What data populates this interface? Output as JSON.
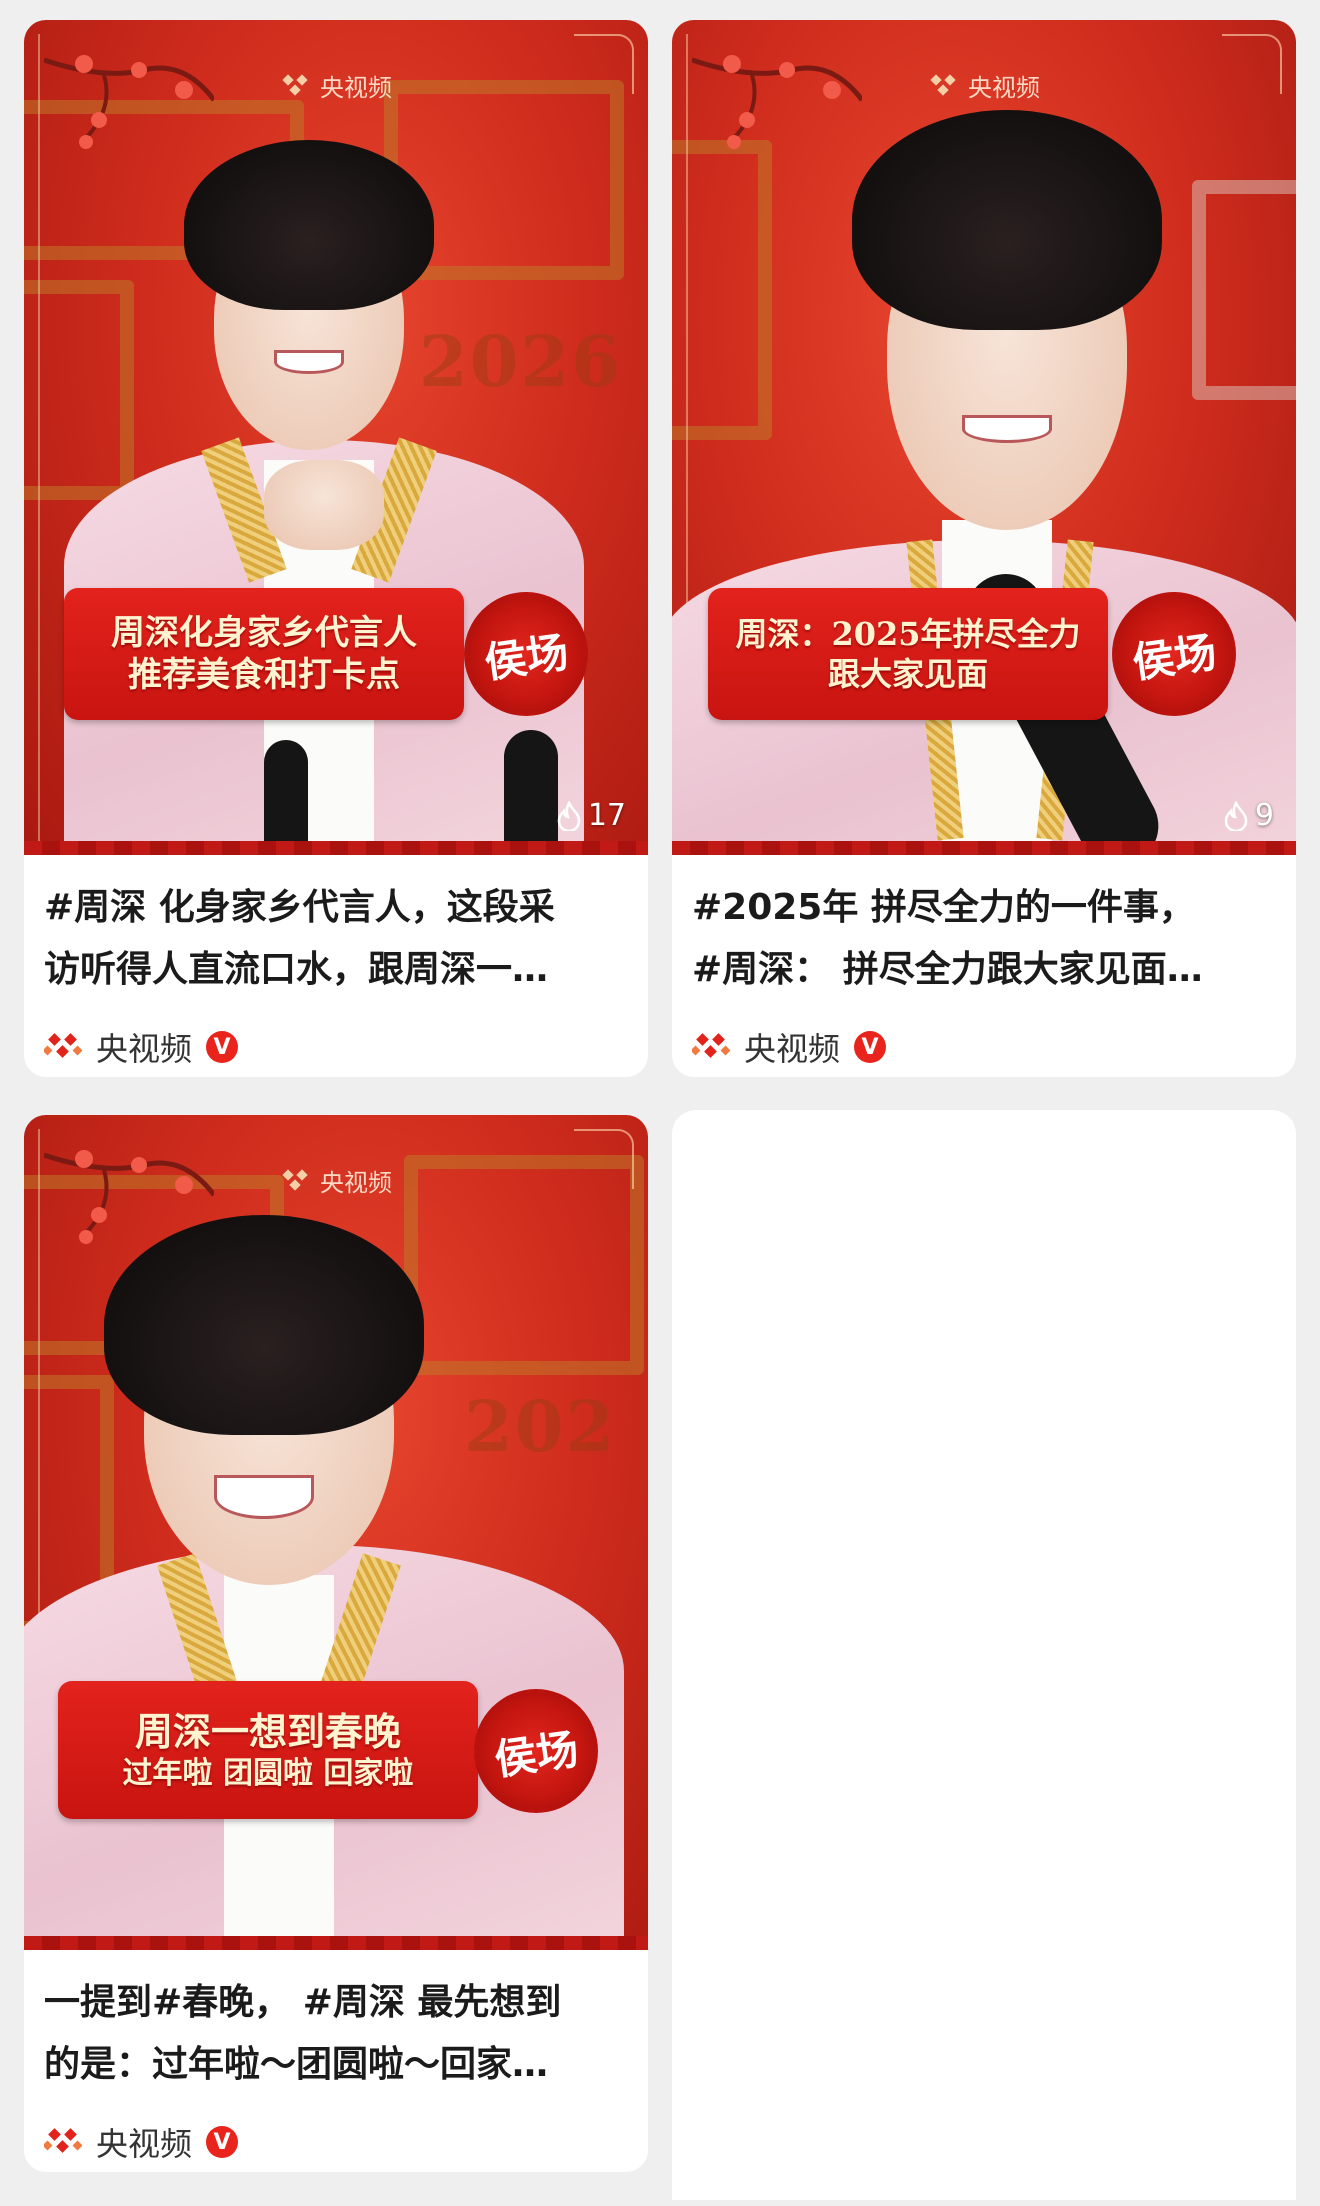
{
  "feed": {
    "cards": [
      {
        "watermark": "央视频",
        "banner_line1": "周深化身家乡代言人",
        "banner_line2": "推荐美食和打卡点",
        "seal_text": "侯场",
        "year_backdrop": "2026",
        "likes": "17",
        "title_line1": "#周深 化身家乡代言人，这段采",
        "title_line2": "访听得人直流口水，跟周深一…",
        "author": "央视频",
        "verified_badge": "V"
      },
      {
        "watermark": "央视频",
        "banner_line1": "周深：2025年拼尽全力",
        "banner_line2": "跟大家见面",
        "seal_text": "侯场",
        "likes": "9",
        "title_line1": "#2025年 拼尽全力的一件事，",
        "title_line2": "#周深： 拼尽全力跟大家见面…",
        "author": "央视频",
        "verified_badge": "V"
      },
      {
        "watermark": "央视频",
        "banner_line1": "周深一想到春晚",
        "banner_line2": "过年啦 团圆啦 回家啦",
        "seal_text": "侯场",
        "year_backdrop": "202",
        "title_line1": "一提到#春晚， #周深 最先想到",
        "title_line2": "的是：过年啦～团圆啦～回家…",
        "author": "央视频",
        "verified_badge": "V"
      }
    ]
  },
  "colors": {
    "brand_red": "#e8241c",
    "background": "#efefef",
    "card": "#ffffff"
  },
  "icons": [
    "flame-icon",
    "cctv-logo-icon",
    "verified-icon"
  ]
}
